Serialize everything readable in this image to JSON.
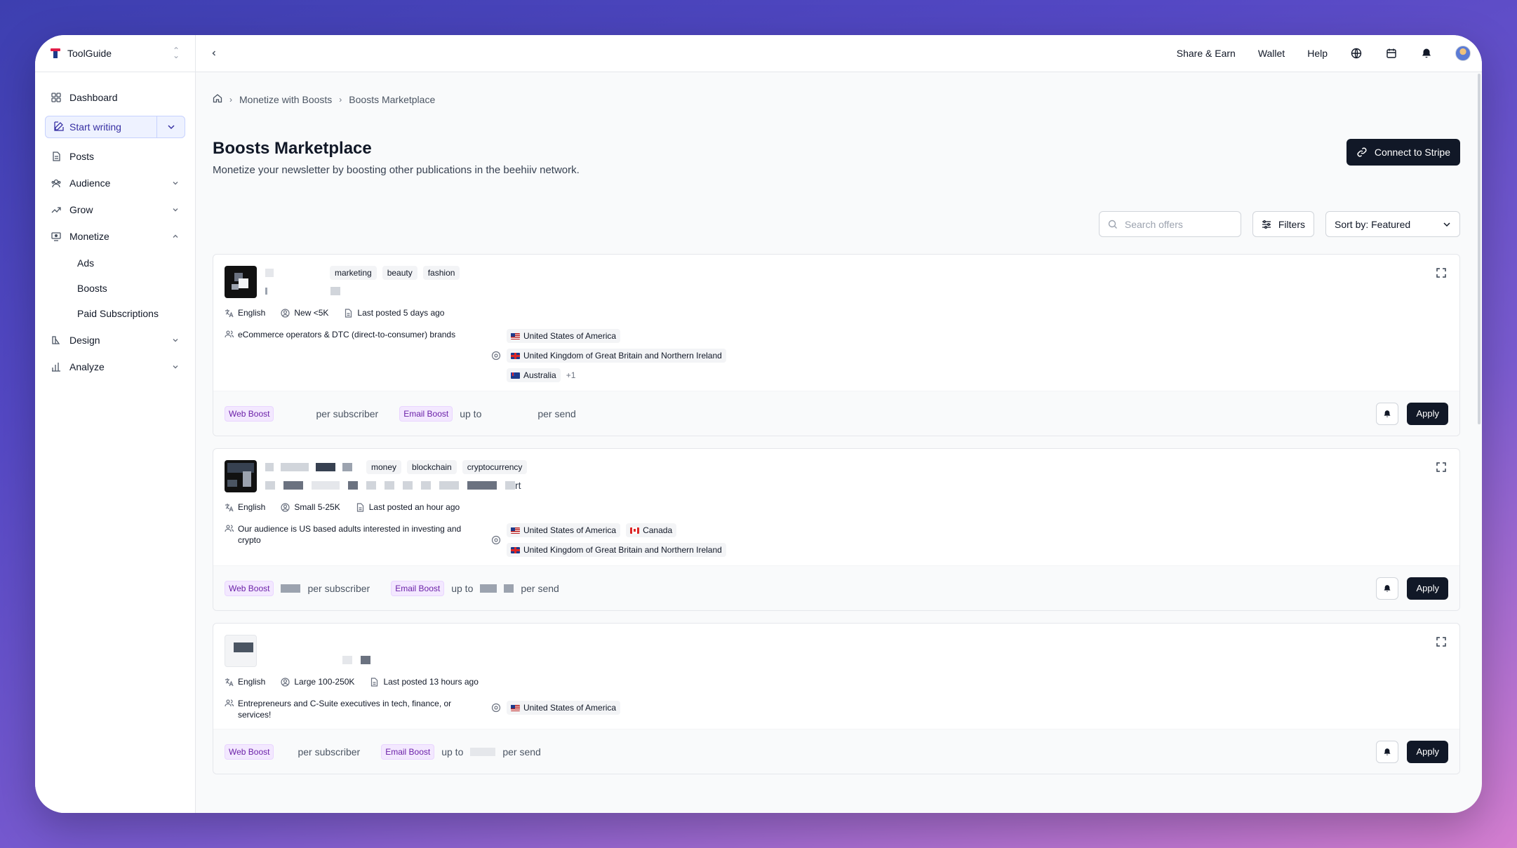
{
  "workspace": {
    "name": "ToolGuide"
  },
  "sidebar": {
    "dashboard": "Dashboard",
    "start_writing": "Start writing",
    "items": [
      {
        "label": "Posts",
        "icon": "document-icon"
      },
      {
        "label": "Audience",
        "icon": "users-icon"
      },
      {
        "label": "Grow",
        "icon": "trending-icon"
      },
      {
        "label": "Monetize",
        "icon": "monetize-icon"
      }
    ],
    "monetize_sub": [
      "Ads",
      "Boosts",
      "Paid Subscriptions"
    ],
    "design": "Design",
    "analyze": "Analyze"
  },
  "topbar": {
    "share": "Share & Earn",
    "wallet": "Wallet",
    "help": "Help"
  },
  "breadcrumb": [
    "Monetize with Boosts",
    "Boosts Marketplace"
  ],
  "page": {
    "title": "Boosts Marketplace",
    "subtitle": "Monetize your newsletter by boosting other publications in the beehiiv network.",
    "stripe": "Connect to Stripe"
  },
  "toolbar": {
    "search_placeholder": "Search offers",
    "filters": "Filters",
    "sort": "Sort by: Featured"
  },
  "cards": [
    {
      "tags": [
        "marketing",
        "beauty",
        "fashion"
      ],
      "language": "English",
      "size": "New <5K",
      "posted": "Last posted 5 days ago",
      "audience": "eCommerce operators & DTC (direct-to-consumer) brands",
      "countries": [
        "United States of America",
        "United Kingdom of Great Britain and Northern Ireland",
        "Australia"
      ],
      "more": "+1",
      "web_boost": "Web Boost",
      "per_sub": "per subscriber",
      "email_boost": "Email Boost",
      "up_to": "up to",
      "per_send": "per send",
      "apply": "Apply"
    },
    {
      "tags": [
        "money",
        "blockchain",
        "cryptocurrency"
      ],
      "title_tail": "rt",
      "language": "English",
      "size": "Small 5-25K",
      "posted": "Last posted an hour ago",
      "audience": "Our audience is US based adults interested in investing and crypto",
      "countries": [
        "United States of America",
        "Canada",
        "United Kingdom of Great Britain and Northern Ireland"
      ],
      "web_boost": "Web Boost",
      "per_sub": "per subscriber",
      "email_boost": "Email Boost",
      "up_to": "up to",
      "per_send": "per send",
      "apply": "Apply"
    },
    {
      "language": "English",
      "size": "Large 100-250K",
      "posted": "Last posted 13 hours ago",
      "audience": "Entrepreneurs and C-Suite executives in tech, finance, or services!",
      "countries": [
        "United States of America"
      ],
      "web_boost": "Web Boost",
      "per_sub": "per subscriber",
      "email_boost": "Email Boost",
      "up_to": "up to",
      "per_send": "per send",
      "apply": "Apply"
    }
  ]
}
